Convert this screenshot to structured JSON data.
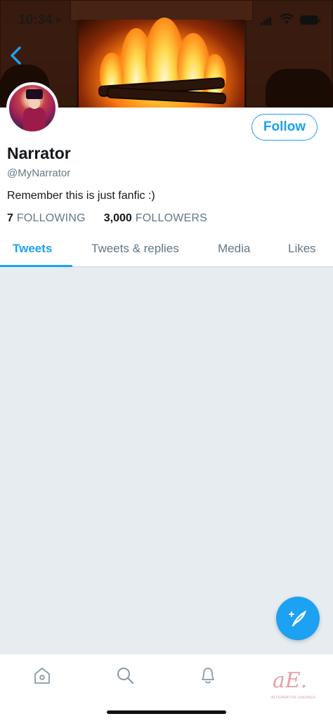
{
  "status_bar": {
    "time": "10:34"
  },
  "profile": {
    "name": "Narrator",
    "handle": "@MyNarrator",
    "bio": "Remember this is just fanfic :)",
    "follow_label": "Follow",
    "following_count": "7",
    "following_label": "FOLLOWING",
    "followers_count": "3,000",
    "followers_label": "FOLLOWERS"
  },
  "tabs": [
    {
      "label": "Tweets",
      "active": true
    },
    {
      "label": "Tweets & replies",
      "active": false
    },
    {
      "label": "Media",
      "active": false
    },
    {
      "label": "Likes",
      "active": false
    }
  ],
  "bottom_nav": {
    "items": [
      "home-icon",
      "search-icon",
      "notifications-icon"
    ],
    "watermark": "aE.",
    "watermark_sub": "ALTERNATIVE ENDINGS"
  },
  "colors": {
    "accent": "#1da1f2",
    "secondary_text": "#657786",
    "timeline_bg": "#e6ecf0"
  }
}
